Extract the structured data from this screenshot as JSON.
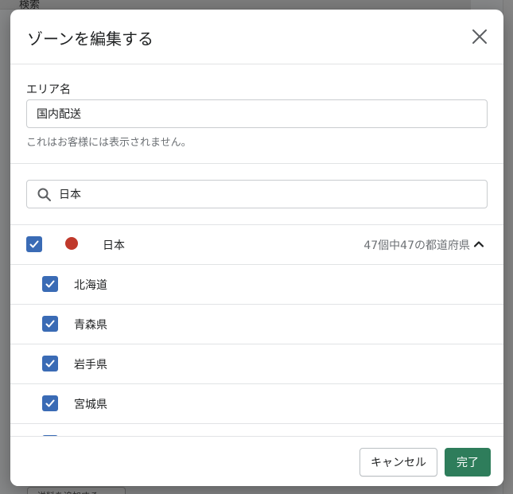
{
  "background": {
    "search_text": "検索",
    "bottom_button": "送料を追加する"
  },
  "modal": {
    "title": "ゾーンを編集する",
    "close_icon": "close-icon",
    "area": {
      "label": "エリア名",
      "value": "国内配送",
      "help": "これはお客様には表示されません。"
    },
    "search": {
      "icon": "search-icon",
      "value": "日本"
    },
    "country": {
      "name": "日本",
      "checked": true,
      "flag_color": "#c0392b",
      "count_text": "47個中47の都道府県"
    },
    "prefectures": [
      {
        "name": "北海道",
        "checked": true
      },
      {
        "name": "青森県",
        "checked": true
      },
      {
        "name": "岩手県",
        "checked": true
      },
      {
        "name": "宮城県",
        "checked": true
      }
    ],
    "footer": {
      "cancel_label": "キャンセル",
      "done_label": "完了"
    }
  },
  "colors": {
    "checkbox": "#3a6bb5",
    "primary": "#2e7d5b"
  }
}
